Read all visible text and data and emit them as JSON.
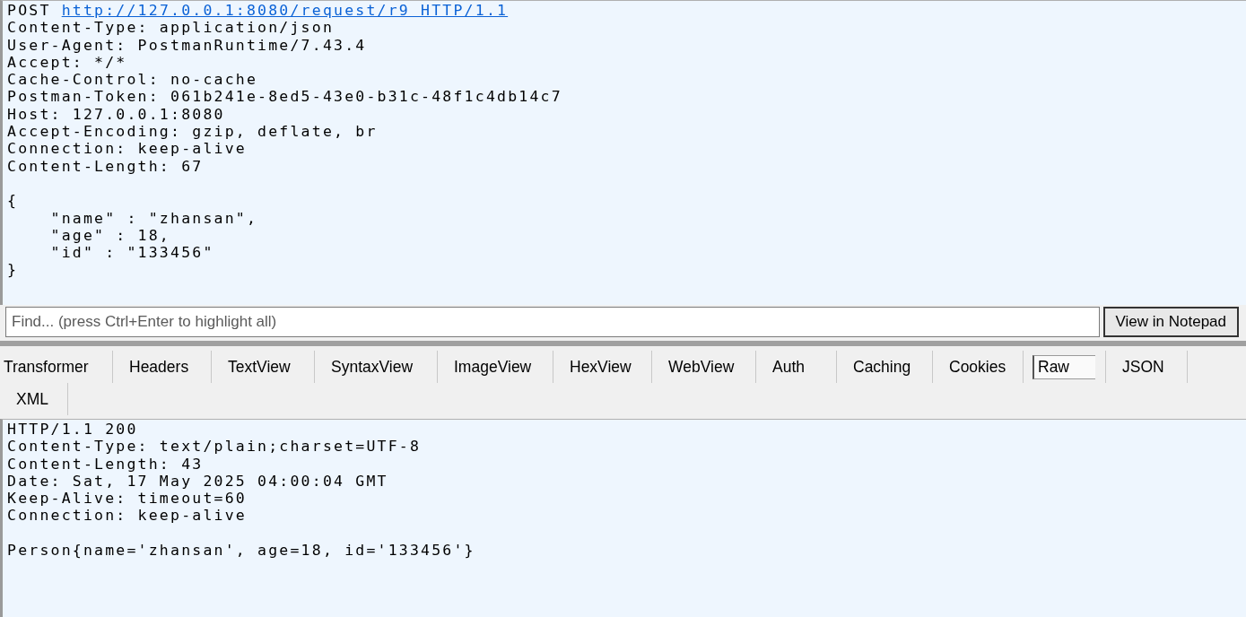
{
  "request": {
    "method": "POST",
    "url": "http://127.0.0.1:8080/request/r9 HTTP/1.1",
    "headers": [
      "Content-Type: application/json",
      "User-Agent: PostmanRuntime/7.43.4",
      "Accept: */*",
      "Cache-Control: no-cache",
      "Postman-Token: 061b241e-8ed5-43e0-b31c-48f1c4db14c7",
      "Host: 127.0.0.1:8080",
      "Accept-Encoding: gzip, deflate, br",
      "Connection: keep-alive",
      "Content-Length: 67"
    ],
    "body": [
      "{",
      "    \"name\" : \"zhansan\",",
      "    \"age\" : 18,",
      "    \"id\" : \"133456\"",
      "}"
    ]
  },
  "find": {
    "placeholder": "Find... (press Ctrl+Enter to highlight all)"
  },
  "notepad_button": "View in Notepad",
  "tabs": [
    {
      "label": "Transformer",
      "selected": false
    },
    {
      "label": "Headers",
      "selected": false
    },
    {
      "label": "TextView",
      "selected": false
    },
    {
      "label": "SyntaxView",
      "selected": false
    },
    {
      "label": "ImageView",
      "selected": false
    },
    {
      "label": "HexView",
      "selected": false
    },
    {
      "label": "WebView",
      "selected": false
    },
    {
      "label": "Auth",
      "selected": false
    },
    {
      "label": "Caching",
      "selected": false
    },
    {
      "label": "Cookies",
      "selected": false
    },
    {
      "label": "Raw",
      "selected": true
    },
    {
      "label": "JSON",
      "selected": false
    },
    {
      "label": "XML",
      "selected": false
    }
  ],
  "response": {
    "status_line": "HTTP/1.1 200",
    "headers": [
      "Content-Type: text/plain;charset=UTF-8",
      "Content-Length: 43",
      "Date: Sat, 17 May 2025 04:00:04 GMT",
      "Keep-Alive: timeout=60",
      "Connection: keep-alive"
    ],
    "body": [
      "Person{name='zhansan', age=18, id='133456'}"
    ]
  }
}
